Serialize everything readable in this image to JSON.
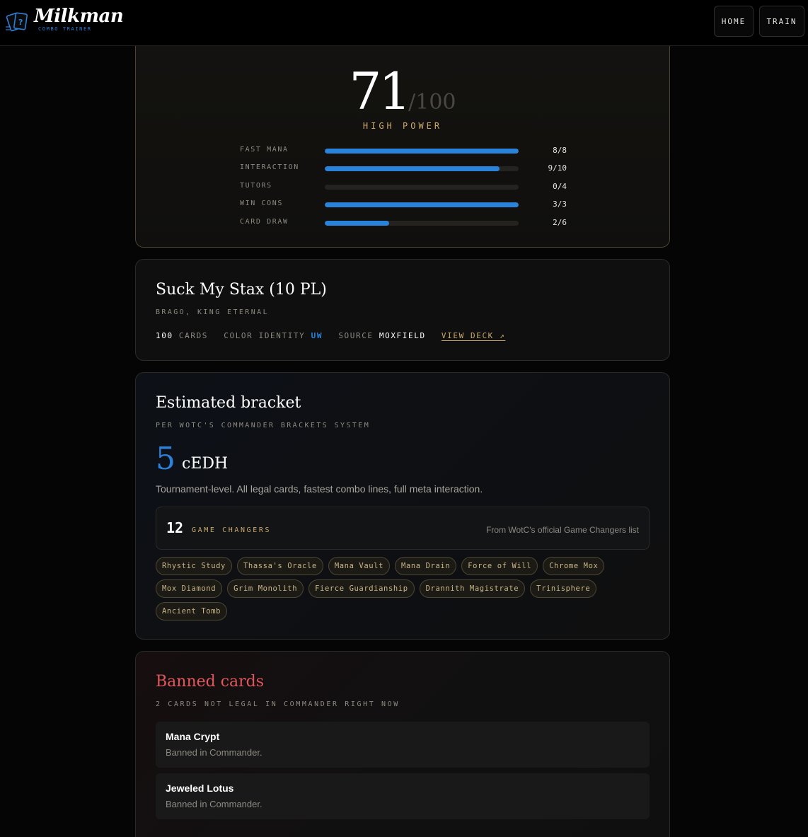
{
  "header": {
    "brand_name": "Milkman",
    "brand_sub": "COMBO TRAINER",
    "nav": [
      {
        "label": "HOME"
      },
      {
        "label": "TRAIN"
      }
    ]
  },
  "score": {
    "value": "71",
    "out_of": "/100",
    "tier": "HIGH POWER",
    "stats": [
      {
        "label": "FAST MANA",
        "value": "8/8",
        "fraction": 1.0
      },
      {
        "label": "INTERACTION",
        "value": "9/10",
        "fraction": 0.9
      },
      {
        "label": "TUTORS",
        "value": "0/4",
        "fraction": 0.0
      },
      {
        "label": "WIN CONS",
        "value": "3/3",
        "fraction": 1.0
      },
      {
        "label": "CARD DRAW",
        "value": "2/6",
        "fraction": 0.333
      }
    ],
    "bar_color": "#2a82db"
  },
  "deck": {
    "title": "Suck My Stax (10 PL)",
    "commander": "BRAGO, KING ETERNAL",
    "card_count": "100",
    "card_count_label": "CARDS",
    "color_identity_label": "COLOR IDENTITY",
    "color_identity": "UW",
    "source_label": "SOURCE",
    "source": "MOXFIELD",
    "view_link": "VIEW DECK ↗"
  },
  "bracket": {
    "title": "Estimated bracket",
    "subtitle": "PER WOTC'S COMMANDER BRACKETS SYSTEM",
    "number": "5",
    "name": "cEDH",
    "description": "Tournament-level. All legal cards, fastest combo lines, full meta interaction.",
    "game_changers_count": "12",
    "game_changers_label": "GAME CHANGERS",
    "game_changers_note": "From WotC's official Game Changers list",
    "cards": [
      "Rhystic Study",
      "Thassa's Oracle",
      "Mana Vault",
      "Mana Drain",
      "Force of Will",
      "Chrome Mox",
      "Mox Diamond",
      "Grim Monolith",
      "Fierce Guardianship",
      "Drannith Magistrate",
      "Trinisphere",
      "Ancient Tomb"
    ]
  },
  "banned": {
    "title": "Banned cards",
    "subtitle": "2 CARDS NOT LEGAL IN COMMANDER RIGHT NOW",
    "items": [
      {
        "name": "Mana Crypt",
        "reason": "Banned in Commander."
      },
      {
        "name": "Jeweled Lotus",
        "reason": "Banned in Commander."
      }
    ]
  },
  "colors": {
    "accent_blue": "#2a82db",
    "gold": "#c9a96b",
    "banned_red": "#e0575d"
  }
}
